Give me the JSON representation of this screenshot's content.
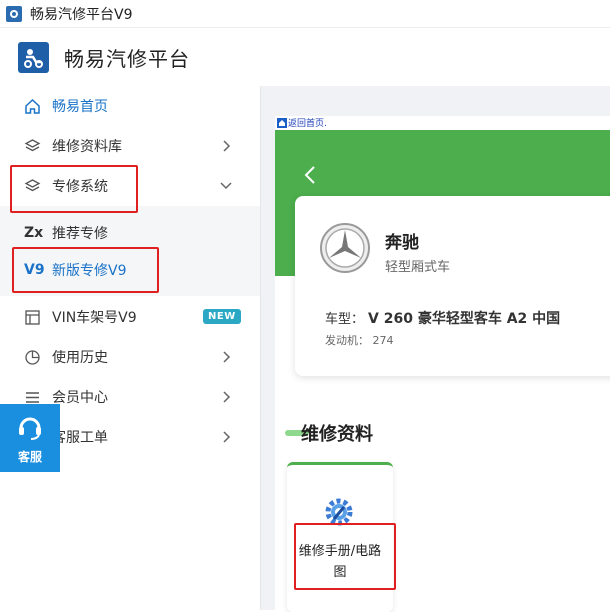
{
  "window": {
    "title": "畅易汽修平台V9"
  },
  "app": {
    "name": "畅易汽修平台"
  },
  "sidebar": {
    "items": [
      {
        "label": "畅易首页",
        "icon": "home-icon",
        "active": true
      },
      {
        "label": "维修资料库",
        "icon": "layers-icon"
      },
      {
        "label": "专修系统",
        "icon": "layers-icon",
        "expanded": true
      },
      {
        "label": "VIN车架号V9",
        "icon": "vin-icon",
        "badge": "NEW"
      },
      {
        "label": "使用历史",
        "icon": "pie-chart-icon"
      },
      {
        "label": "会员中心",
        "icon": "list-icon"
      },
      {
        "label": "客服工单",
        "icon": "ticket-icon"
      }
    ],
    "submenu": [
      {
        "prefix": "Zx",
        "label": "推荐专修"
      },
      {
        "prefix": "V9",
        "label": "新版专修V9",
        "current": true
      }
    ]
  },
  "kefu": {
    "label": "客服"
  },
  "main": {
    "back_home": "返回首页.",
    "vehicle": {
      "brand": "奔驰",
      "type": "轻型厢式车",
      "model_label": "车型：",
      "model": "V 260 豪华轻型客车 A2 中国",
      "engine_label": "发动机：",
      "engine": "274"
    },
    "section_title": "维修资料",
    "tiles": [
      {
        "label": "维修手册/电路图",
        "icon": "gear-wrench-icon"
      }
    ]
  },
  "colors": {
    "accent": "#1a73c8",
    "green": "#4cae4c",
    "highlight": "#e02020",
    "kefu": "#1a8fe0"
  }
}
